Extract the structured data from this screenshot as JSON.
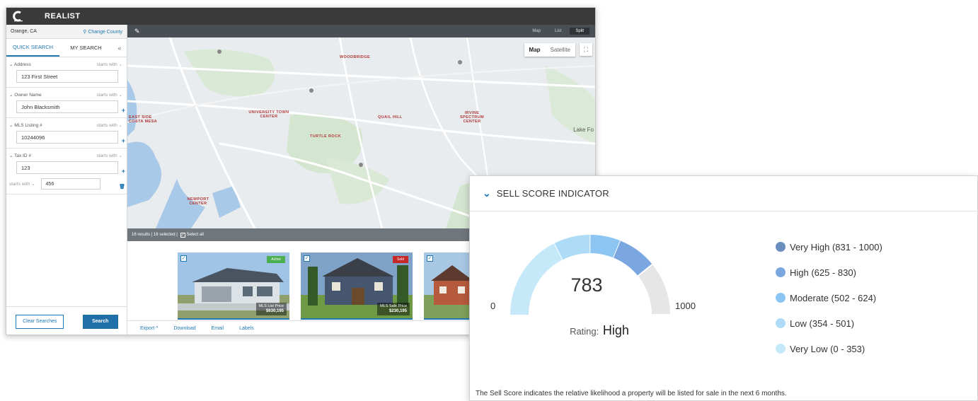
{
  "app": {
    "title": "REALIST",
    "location": "Orange, CA",
    "change_county": "Change County",
    "tabs": [
      "QUICK SEARCH",
      "MY SEARCH"
    ],
    "collapse_icon": "«",
    "fields": [
      {
        "label": "Address",
        "op": "starts with",
        "value": "123 First Street"
      },
      {
        "label": "Owner Name",
        "op": "starts with",
        "value": "John Blacksmith"
      },
      {
        "label": "MLS Listing #",
        "op": "starts with",
        "value": "10244096"
      },
      {
        "label": "Tax ID #",
        "op": "starts with",
        "value": "123"
      }
    ],
    "range": {
      "op": "starts with",
      "value": "456"
    },
    "clear_label": "Clear Searches",
    "search_label": "Search"
  },
  "map": {
    "views": [
      "Map",
      "List",
      "Split"
    ],
    "map_type": [
      "Map",
      "Satellite"
    ],
    "labels": {
      "woodbridge": "WOODBRIDGE",
      "university_town_center": "UNIVERSITY TOWN CENTER",
      "quail_hill": "QUAIL HILL",
      "irvine_spectrum": "IRVINE SPECTRUM CENTER",
      "turtle_rock": "TURTLE ROCK",
      "east_side": "EAST SIDE COSTA MESA",
      "newport_center": "NEWPORT CENTER",
      "lake_forest": "Lake Fo"
    }
  },
  "results": {
    "count": "16 results",
    "selected": "16 selected",
    "select_all": "Select all",
    "cards": [
      {
        "badge": "Active",
        "badge_color": "#4caf50",
        "price_label": "MLS List Price",
        "price": "$630,195"
      },
      {
        "badge": "Sold",
        "badge_color": "#c62828",
        "price_label": "MLS Sale Price",
        "price": "$230,195"
      }
    ],
    "actions": [
      "Export ^",
      "Download",
      "Email",
      "Labels"
    ]
  },
  "sell": {
    "title": "SELL SCORE INDICATOR",
    "score": "783",
    "min": "0",
    "max": "1000",
    "rating_label": "Rating:",
    "rating_value": "High",
    "legend": [
      {
        "label": "Very High (831 - 1000)",
        "color": "#6c8ebf"
      },
      {
        "label": "High (625 - 830)",
        "color": "#7ba7e1"
      },
      {
        "label": "Moderate (502 - 624)",
        "color": "#8dc5f2"
      },
      {
        "label": "Low (354 - 501)",
        "color": "#aedcf7"
      },
      {
        "label": "Very Low (0 - 353)",
        "color": "#c6e9fa"
      }
    ],
    "footnote": "The Sell Score indicates the relative likelihood a property will be listed for sale in the next 6 months."
  }
}
